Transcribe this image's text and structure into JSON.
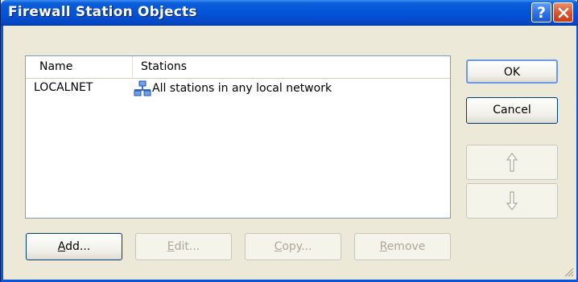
{
  "window": {
    "title": "Firewall Station Objects",
    "help_icon": "question-mark",
    "close_icon": "x"
  },
  "list": {
    "columns": [
      "Name",
      "Stations"
    ],
    "rows": [
      {
        "name": "LOCALNET",
        "stations": "All stations in any local network",
        "icon": "network-icon"
      }
    ]
  },
  "buttons": {
    "ok": "OK",
    "cancel": "Cancel",
    "move_up_icon": "arrow-up",
    "move_down_icon": "arrow-down",
    "add_prefix": "A",
    "add_rest": "dd...",
    "edit_prefix": "E",
    "edit_rest": "dit...",
    "copy_prefix": "C",
    "copy_rest": "opy...",
    "remove_prefix": "R",
    "remove_rest": "emove"
  },
  "colors": {
    "title_bar": "#0453d8",
    "close_button": "#d8532b",
    "dialog_background": "#ece9d8"
  }
}
